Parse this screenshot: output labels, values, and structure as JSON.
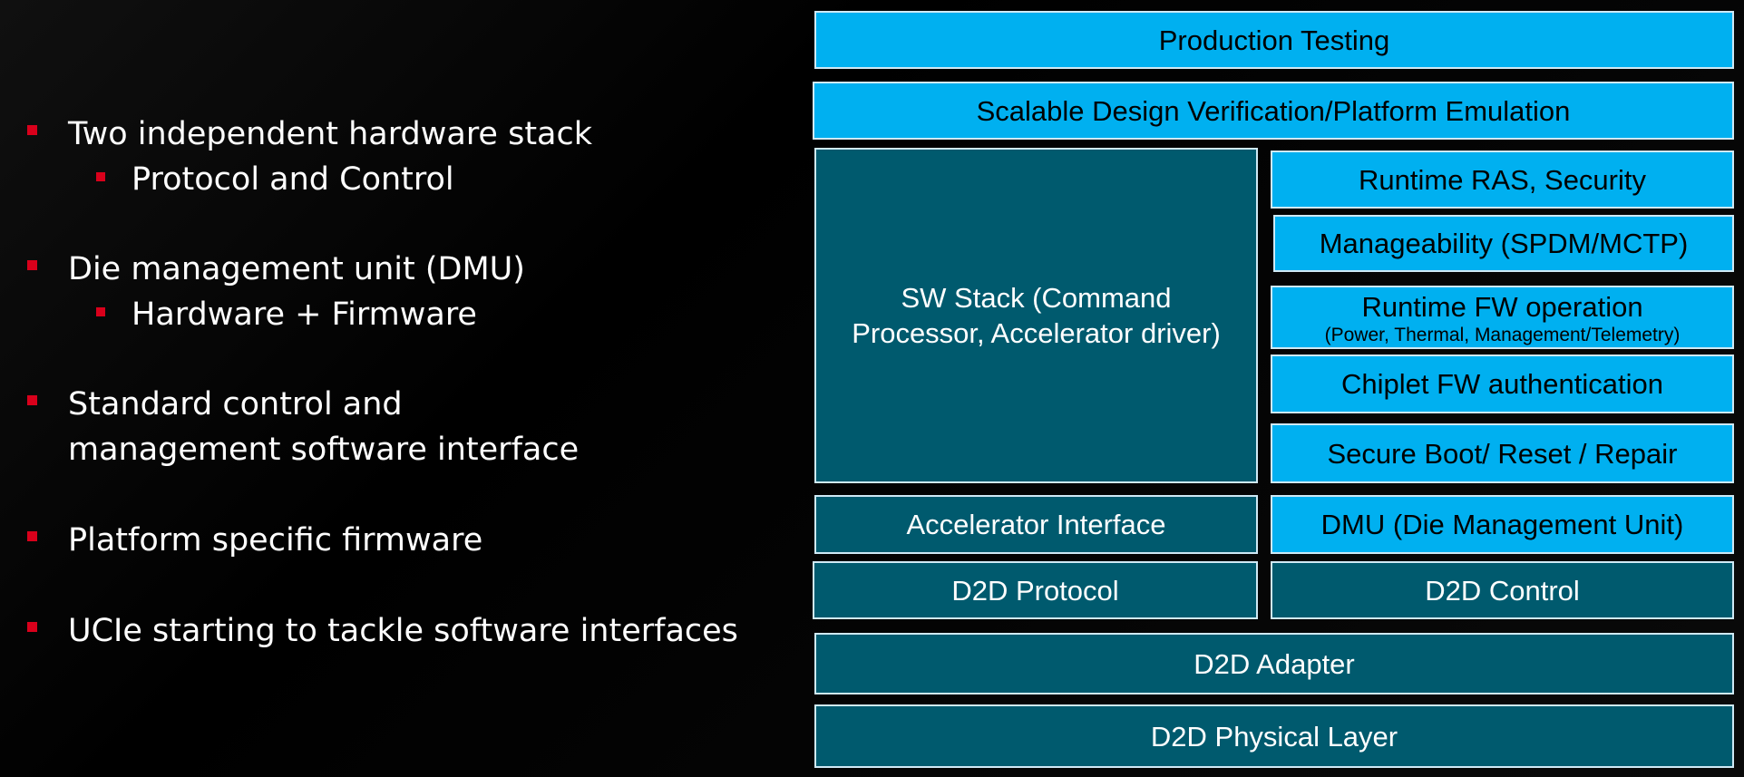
{
  "bullets": [
    {
      "text": "Two independent hardware stack",
      "level": 1
    },
    {
      "text": "Protocol and Control",
      "level": 2
    },
    {
      "text": "Die management unit (DMU)",
      "level": 1
    },
    {
      "text": "Hardware + Firmware",
      "level": 2
    },
    {
      "text": "Standard control and management software interface",
      "level": 1
    },
    {
      "text": "Platform specific firmware",
      "level": 1
    },
    {
      "text": "UCIe starting to tackle software interfaces",
      "level": 1
    }
  ],
  "stack": {
    "production_testing": "Production Testing",
    "scalable_verification": "Scalable Design Verification/Platform Emulation",
    "sw_stack": "SW Stack (Command Processor, Accelerator driver)",
    "runtime_ras": "Runtime RAS, Security",
    "manageability": "Manageability (SPDM/MCTP)",
    "runtime_fw": "Runtime FW operation",
    "runtime_fw_detail": "(Power, Thermal, Management/Telemetry)",
    "chiplet_fw_auth": "Chiplet FW authentication",
    "secure_boot": "Secure Boot/ Reset / Repair",
    "accelerator_interface": "Accelerator Interface",
    "dmu": "DMU (Die Management Unit)",
    "d2d_protocol": "D2D Protocol",
    "d2d_control": "D2D Control",
    "d2d_adapter": "D2D Adapter",
    "d2d_physical": "D2D Physical Layer"
  },
  "colors": {
    "light_block": "#00b0f0",
    "dark_block": "#005a6e",
    "bullet_marker": "#d9001b"
  }
}
